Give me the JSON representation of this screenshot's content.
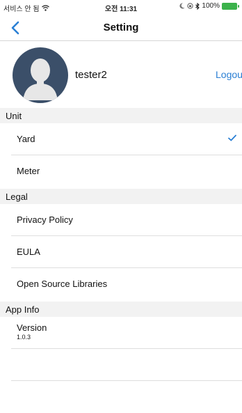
{
  "status_bar": {
    "carrier": "서비스 안 됨",
    "time": "오전 11:31",
    "battery_percent": "100%",
    "battery_level": 1.0,
    "battery_color": "#3bb24b"
  },
  "nav": {
    "back_icon": "chevron-left-icon",
    "title": "Setting"
  },
  "profile": {
    "username": "tester2",
    "logout_label": "Logout"
  },
  "sections": {
    "unit": {
      "header": "Unit",
      "items": [
        {
          "label": "Yard",
          "selected": true
        },
        {
          "label": "Meter",
          "selected": false
        }
      ]
    },
    "legal": {
      "header": "Legal",
      "items": [
        {
          "label": "Privacy Policy"
        },
        {
          "label": "EULA"
        },
        {
          "label": "Open Source Libraries"
        }
      ]
    },
    "app_info": {
      "header": "App Info",
      "version_label": "Version",
      "version_value": "1.0.3"
    }
  },
  "colors": {
    "accent": "#2a7fd4",
    "avatar_bg": "#3b4f69",
    "section_bg": "#f2f2f2"
  }
}
